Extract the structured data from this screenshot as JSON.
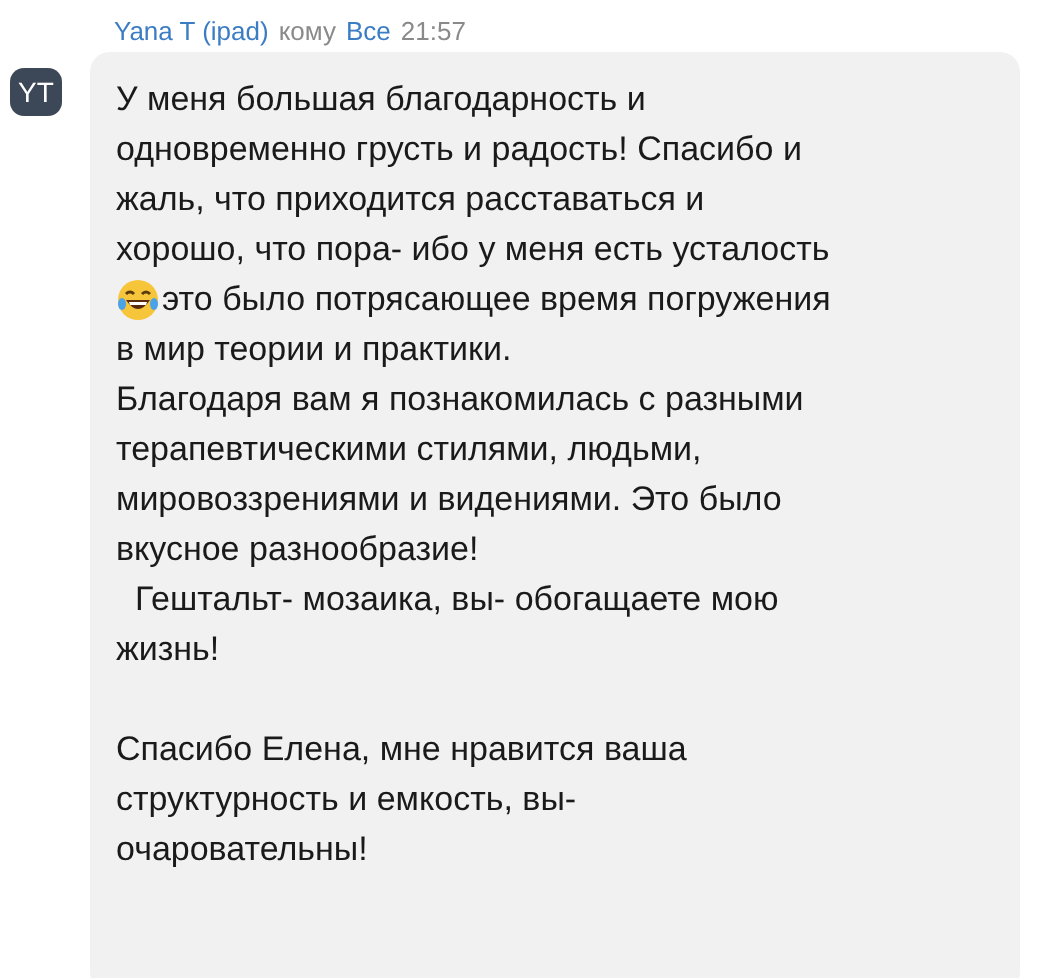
{
  "header": {
    "sender": "Yana T (ipad)",
    "to_word": "кому",
    "recipient": "Все",
    "time": "21:57"
  },
  "avatar": {
    "initials": "YT"
  },
  "message": {
    "paragraphs": [
      {
        "lines": [
          {
            "text": "У меня большая благодарность и"
          },
          {
            "text": "одновременно грусть и радость! Спасибо и"
          },
          {
            "text": "жаль, что приходится расставаться и"
          },
          {
            "text": "хорошо, что пора- ибо у меня есть усталость"
          },
          {
            "text": "это было потрясающее время погружения",
            "emoji": true
          },
          {
            "text": "в мир теории и практики."
          },
          {
            "text": "Благодаря вам я познакомилась с разными"
          },
          {
            "text": "терапевтическими стилями, людьми,"
          },
          {
            "text": "мировоззрениями и видениями. Это было"
          },
          {
            "text": "вкусное разнообразие!"
          },
          {
            "text": "  Гештальт- мозаика, вы- обогащаете мою"
          },
          {
            "text": "жизнь!"
          }
        ]
      },
      {
        "lines": [
          {
            "text": "Спасибо Елена, мне нравится ваша"
          },
          {
            "text": "структурность и емкость, вы-"
          },
          {
            "text": "очаровательны!"
          }
        ]
      }
    ]
  }
}
